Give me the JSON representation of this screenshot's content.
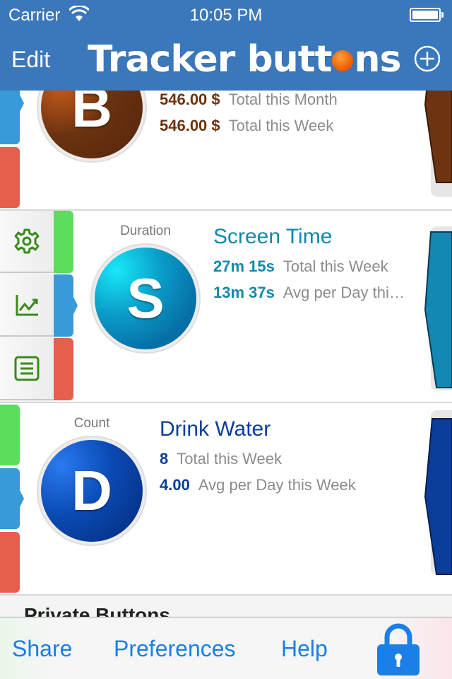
{
  "status_bar": {
    "carrier": "Carrier",
    "time": "10:05 PM"
  },
  "nav": {
    "edit_label": "Edit",
    "title_part1": "Tracker butt",
    "title_part2": "ns"
  },
  "rows": [
    {
      "letter": "B",
      "color": "#6b3210",
      "stats": [
        {
          "value": "546.00 $",
          "label": "Total this Month"
        },
        {
          "value": "546.00 $",
          "label": "Total this Week"
        }
      ]
    },
    {
      "type": "Duration",
      "letter": "S",
      "title": "Screen Time",
      "color": "#1288aa",
      "stats": [
        {
          "value": "27m 15s",
          "label": "Total this Week"
        },
        {
          "value": "13m 37s",
          "label": "Avg per Day thi…"
        }
      ]
    },
    {
      "type": "Count",
      "letter": "D",
      "title": "Drink Water",
      "color": "#0a3e9a",
      "stats": [
        {
          "value": "8",
          "label": "Total this Week"
        },
        {
          "value": "4.00",
          "label": "Avg per Day this Week"
        }
      ]
    }
  ],
  "section": {
    "title": "Private Buttons"
  },
  "toolbar": {
    "share": "Share",
    "preferences": "Preferences",
    "help": "Help"
  }
}
